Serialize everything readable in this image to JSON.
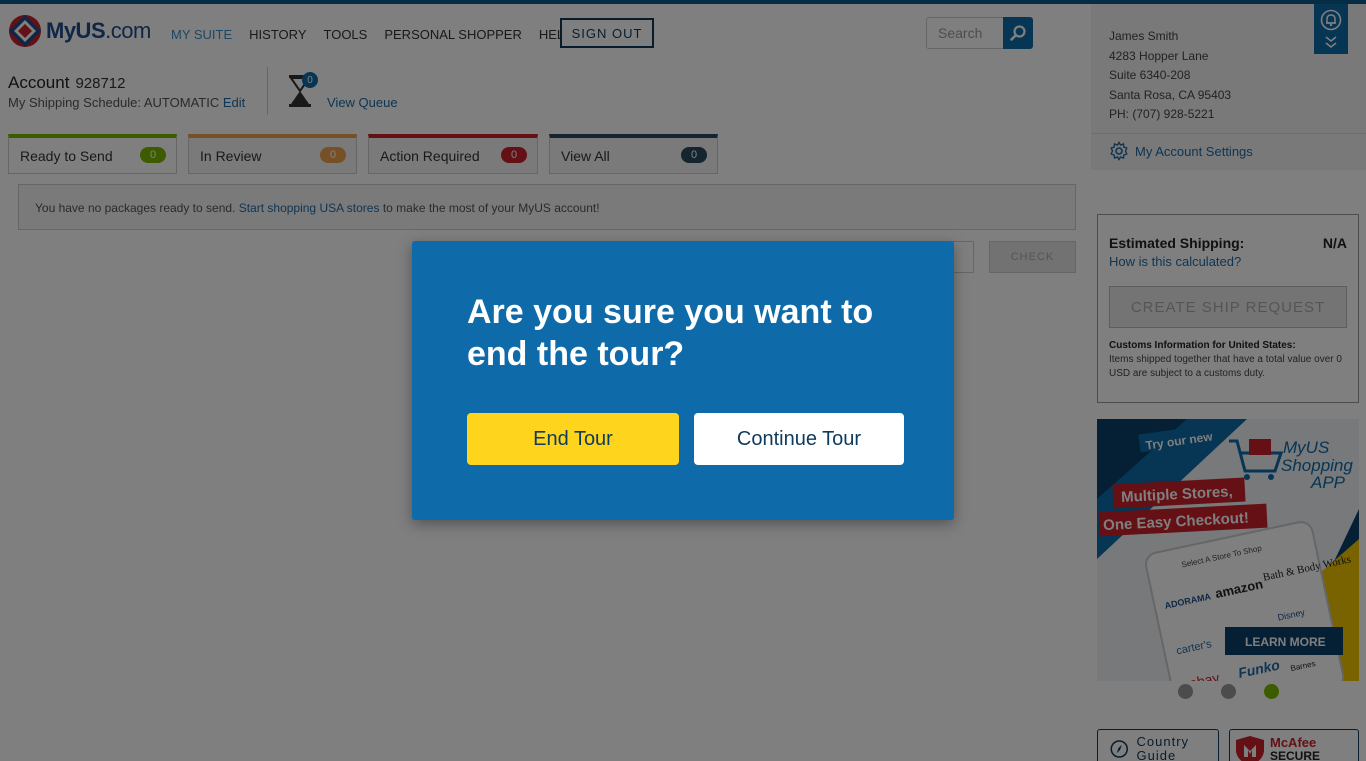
{
  "header": {
    "logo_text": "MyUS",
    "logo_suffix": ".com",
    "nav": [
      "MY SUITE",
      "HISTORY",
      "TOOLS",
      "PERSONAL SHOPPER",
      "HELP"
    ],
    "signout_label": "SIGN OUT",
    "search_placeholder": "Search"
  },
  "account": {
    "title": "Account",
    "number": "928712",
    "schedule_label": "My Shipping Schedule: AUTOMATIC",
    "edit_label": "Edit",
    "queue_count": "0",
    "queue_label": "View Queue"
  },
  "tabs": [
    {
      "label": "Ready to Send",
      "count": "0",
      "color": "#7ab800"
    },
    {
      "label": "In Review",
      "count": "0",
      "color": "#f0a050"
    },
    {
      "label": "Action Required",
      "count": "0",
      "color": "#c8202a"
    },
    {
      "label": "View All",
      "count": "0",
      "color": "#2a4a5e"
    }
  ],
  "notice": {
    "before": "You have no packages ready to send.",
    "link": "Start shopping USA stores",
    "after": "to make the most of your MyUS account!"
  },
  "check_label": "CHECK",
  "address": {
    "name": "James Smith",
    "line1": "4283 Hopper Lane",
    "line2": "Suite 6340-208",
    "city": "Santa Rosa, CA 95403",
    "phone": "PH: (707) 928-5221"
  },
  "settings_label": "My Account Settings",
  "estimate": {
    "label": "Estimated Shipping:",
    "value": "N/A",
    "link": "How is this calculated?",
    "button": "CREATE SHIP REQUEST",
    "customs_title": "Customs Information for United States:",
    "customs_text": "Items shipped together that have a total value over 0 USD are subject to a customs duty."
  },
  "ad": {
    "try": "Try our new",
    "app_title_1": "MyUS",
    "app_title_2": "Shopping",
    "app_title_3": "APP",
    "banner1": "Multiple Stores,",
    "banner2": "One Easy Checkout!",
    "phone_header": "Select A Store To Shop",
    "stores": [
      "ADORAMA",
      "amazon",
      "Bath & Body Works",
      "carter's",
      "Disney",
      "ebay",
      "Funko",
      "Barnes"
    ],
    "learn_more": "LEARN MORE"
  },
  "country_guide": "Country Guide",
  "mcafee": {
    "top": "McAfee",
    "bottom": "SECURE"
  },
  "modal": {
    "question": "Are you sure you want to end the tour?",
    "end_label": "End Tour",
    "continue_label": "Continue Tour"
  }
}
